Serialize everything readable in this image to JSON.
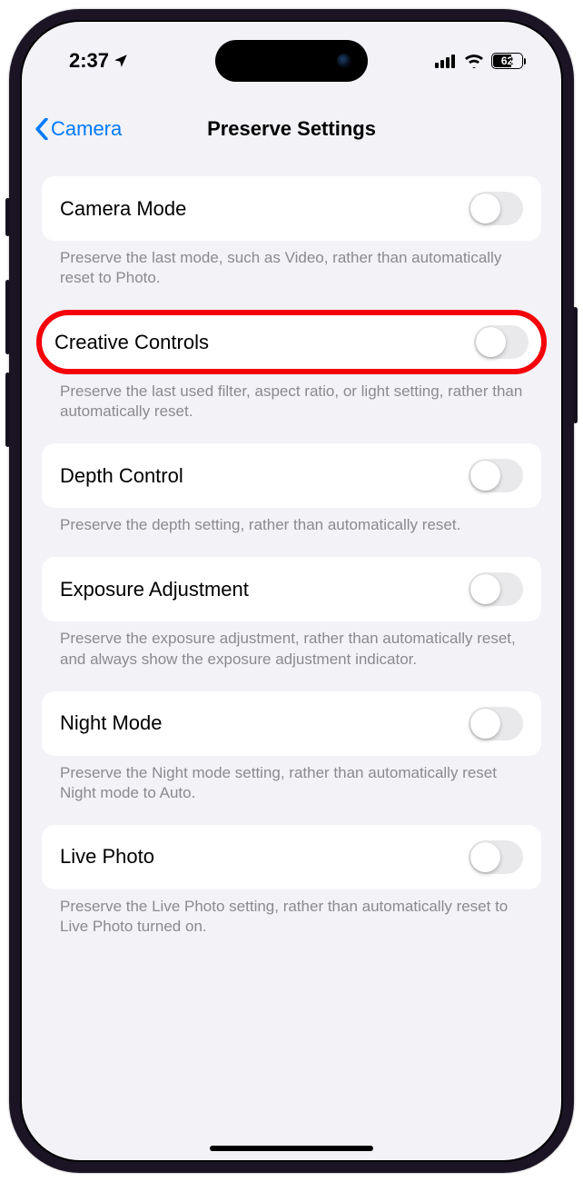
{
  "status": {
    "time": "2:37",
    "battery": "62"
  },
  "nav": {
    "back": "Camera",
    "title": "Preserve Settings"
  },
  "items": [
    {
      "label": "Camera Mode",
      "desc": "Preserve the last mode, such as Video, rather than automatically reset to Photo."
    },
    {
      "label": "Creative Controls",
      "desc": "Preserve the last used filter, aspect ratio, or light setting, rather than automatically reset."
    },
    {
      "label": "Depth Control",
      "desc": "Preserve the depth setting, rather than automatically reset."
    },
    {
      "label": "Exposure Adjustment",
      "desc": "Preserve the exposure adjustment, rather than automatically reset, and always show the exposure adjustment indicator."
    },
    {
      "label": "Night Mode",
      "desc": "Preserve the Night mode setting, rather than automatically reset Night mode to Auto."
    },
    {
      "label": "Live Photo",
      "desc": "Preserve the Live Photo setting, rather than automatically reset to Live Photo turned on."
    }
  ]
}
